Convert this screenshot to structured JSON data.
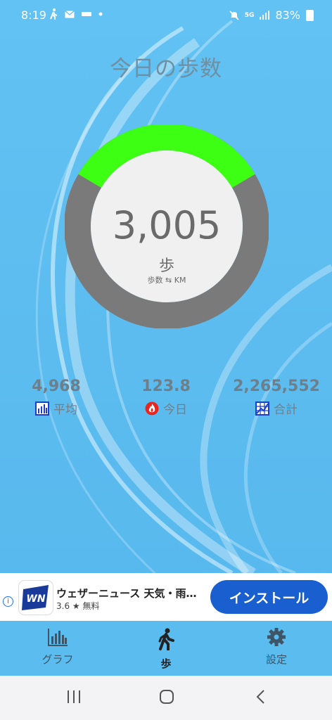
{
  "status_bar": {
    "time": "8:19",
    "network": "5G",
    "battery": "83%"
  },
  "header": {
    "title": "今日の歩数"
  },
  "steps": {
    "value": "3,005",
    "unit": "歩",
    "toggle_label": "歩数 ⇆ KM",
    "progress_fraction": 0.33
  },
  "stats": [
    {
      "value": "4,968",
      "label": "平均",
      "icon": "bar-chart-icon"
    },
    {
      "value": "123.8",
      "label": "今日",
      "icon": "flame-icon"
    },
    {
      "value": "2,265,552",
      "label": "合計",
      "icon": "grid-chart-icon"
    }
  ],
  "ad": {
    "title": "ウェザーニュース 天気・雨…",
    "rating": "3.6 ★ 無料",
    "button": "インストール",
    "logo_text": "WN"
  },
  "tabs": [
    {
      "label": "グラフ",
      "icon": "bar-chart-icon"
    },
    {
      "label": "歩",
      "icon": "walking-icon"
    },
    {
      "label": "設定",
      "icon": "gear-icon"
    }
  ],
  "colors": {
    "background": "#5bbcef",
    "ring_progress": "#3cff14",
    "ring_track": "#7a7a7a",
    "accent_blue": "#1a5fd0"
  }
}
